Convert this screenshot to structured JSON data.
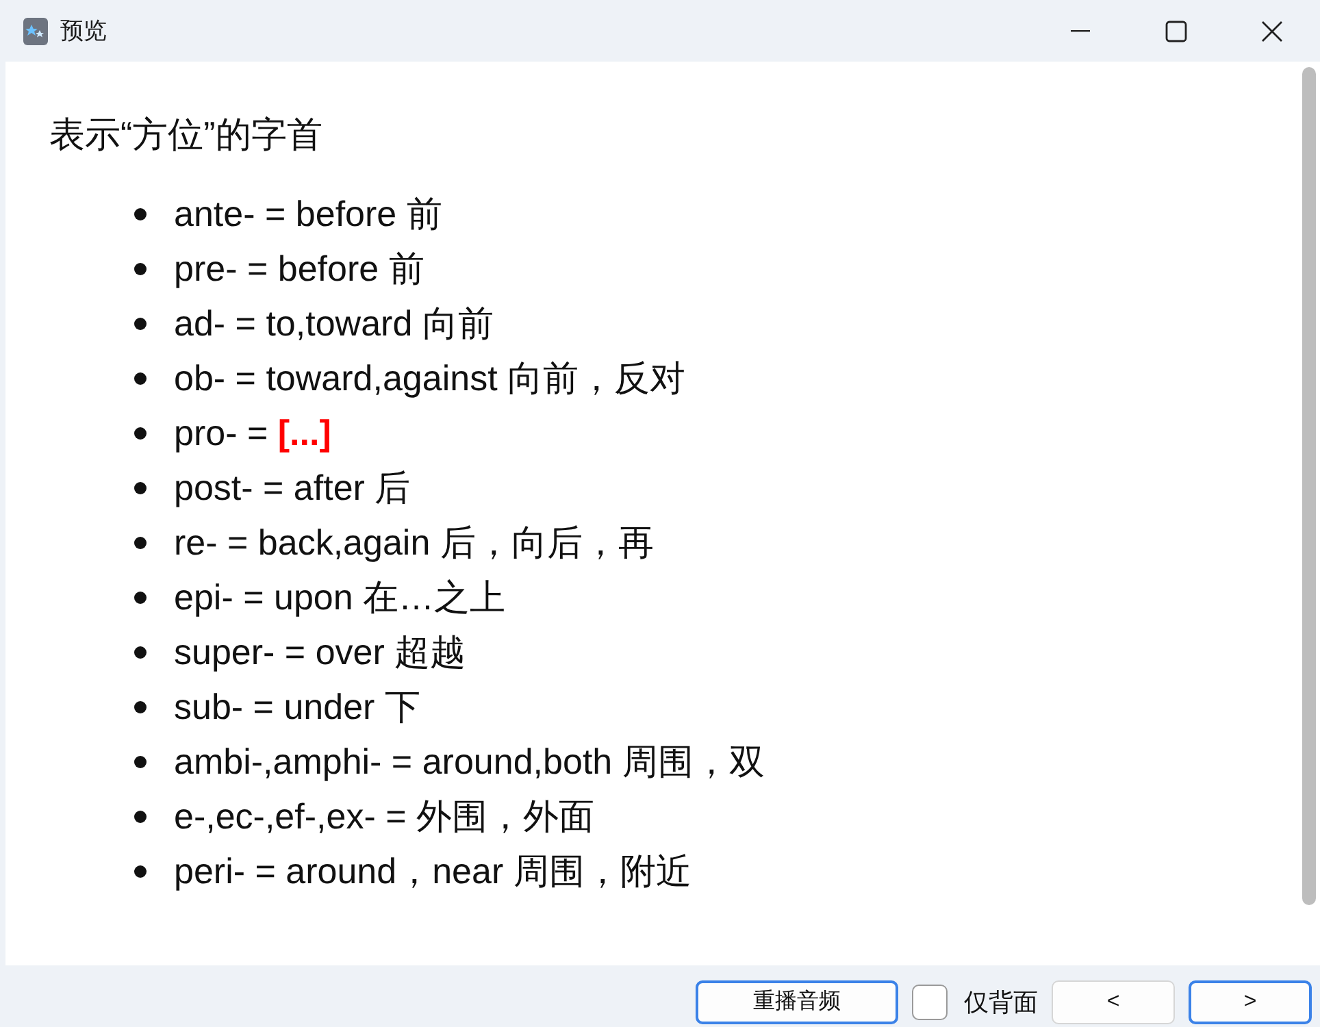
{
  "window": {
    "title": "预览"
  },
  "heading": "表示“方位”的字首",
  "items": [
    {
      "text": "ante- = before 前"
    },
    {
      "text": "pre- = before 前"
    },
    {
      "text": "ad- = to,toward 向前"
    },
    {
      "text": "ob- = toward,against 向前，反对"
    },
    {
      "text": "pro- = ",
      "cloze": "[...]"
    },
    {
      "text": "post- = after 后"
    },
    {
      "text": "re- = back,again 后，向后，再"
    },
    {
      "text": "epi- = upon 在…之上"
    },
    {
      "text": "super- = over 超越"
    },
    {
      "text": "sub- = under 下"
    },
    {
      "text": "ambi-,amphi- = around,both 周围，双"
    },
    {
      "text": "e-,ec-,ef-,ex- = 外围，外面"
    },
    {
      "text": "peri- = around，near 周围，附近"
    }
  ],
  "replay_button": {
    "label": "重播音频",
    "highlighted": true
  },
  "back_only": {
    "label": "仅背面",
    "checked": false
  },
  "nav_buttons": [
    {
      "label": "<",
      "highlighted": false
    },
    {
      "label": ">",
      "highlighted": true
    }
  ]
}
